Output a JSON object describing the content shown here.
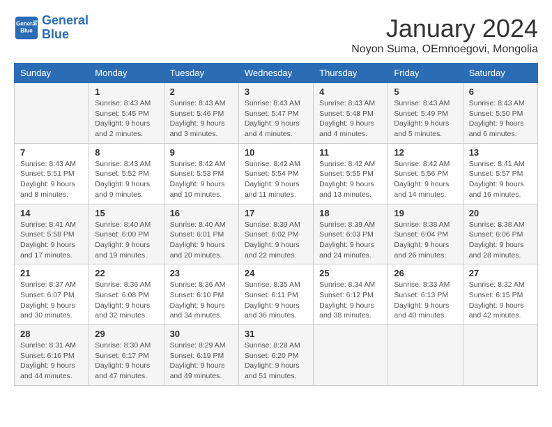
{
  "header": {
    "logo_line1": "General",
    "logo_line2": "Blue",
    "title": "January 2024",
    "subtitle": "Noyon Suma, OEmnoegovi, Mongolia"
  },
  "weekdays": [
    "Sunday",
    "Monday",
    "Tuesday",
    "Wednesday",
    "Thursday",
    "Friday",
    "Saturday"
  ],
  "weeks": [
    [
      {
        "day": "",
        "info": ""
      },
      {
        "day": "1",
        "info": "Sunrise: 8:43 AM\nSunset: 5:45 PM\nDaylight: 9 hours\nand 2 minutes."
      },
      {
        "day": "2",
        "info": "Sunrise: 8:43 AM\nSunset: 5:46 PM\nDaylight: 9 hours\nand 3 minutes."
      },
      {
        "day": "3",
        "info": "Sunrise: 8:43 AM\nSunset: 5:47 PM\nDaylight: 9 hours\nand 4 minutes."
      },
      {
        "day": "4",
        "info": "Sunrise: 8:43 AM\nSunset: 5:48 PM\nDaylight: 9 hours\nand 4 minutes."
      },
      {
        "day": "5",
        "info": "Sunrise: 8:43 AM\nSunset: 5:49 PM\nDaylight: 9 hours\nand 5 minutes."
      },
      {
        "day": "6",
        "info": "Sunrise: 8:43 AM\nSunset: 5:50 PM\nDaylight: 9 hours\nand 6 minutes."
      }
    ],
    [
      {
        "day": "7",
        "info": "Sunrise: 8:43 AM\nSunset: 5:51 PM\nDaylight: 9 hours\nand 8 minutes."
      },
      {
        "day": "8",
        "info": "Sunrise: 8:43 AM\nSunset: 5:52 PM\nDaylight: 9 hours\nand 9 minutes."
      },
      {
        "day": "9",
        "info": "Sunrise: 8:42 AM\nSunset: 5:53 PM\nDaylight: 9 hours\nand 10 minutes."
      },
      {
        "day": "10",
        "info": "Sunrise: 8:42 AM\nSunset: 5:54 PM\nDaylight: 9 hours\nand 11 minutes."
      },
      {
        "day": "11",
        "info": "Sunrise: 8:42 AM\nSunset: 5:55 PM\nDaylight: 9 hours\nand 13 minutes."
      },
      {
        "day": "12",
        "info": "Sunrise: 8:42 AM\nSunset: 5:56 PM\nDaylight: 9 hours\nand 14 minutes."
      },
      {
        "day": "13",
        "info": "Sunrise: 8:41 AM\nSunset: 5:57 PM\nDaylight: 9 hours\nand 16 minutes."
      }
    ],
    [
      {
        "day": "14",
        "info": "Sunrise: 8:41 AM\nSunset: 5:58 PM\nDaylight: 9 hours\nand 17 minutes."
      },
      {
        "day": "15",
        "info": "Sunrise: 8:40 AM\nSunset: 6:00 PM\nDaylight: 9 hours\nand 19 minutes."
      },
      {
        "day": "16",
        "info": "Sunrise: 8:40 AM\nSunset: 6:01 PM\nDaylight: 9 hours\nand 20 minutes."
      },
      {
        "day": "17",
        "info": "Sunrise: 8:39 AM\nSunset: 6:02 PM\nDaylight: 9 hours\nand 22 minutes."
      },
      {
        "day": "18",
        "info": "Sunrise: 8:39 AM\nSunset: 6:03 PM\nDaylight: 9 hours\nand 24 minutes."
      },
      {
        "day": "19",
        "info": "Sunrise: 8:38 AM\nSunset: 6:04 PM\nDaylight: 9 hours\nand 26 minutes."
      },
      {
        "day": "20",
        "info": "Sunrise: 8:38 AM\nSunset: 6:06 PM\nDaylight: 9 hours\nand 28 minutes."
      }
    ],
    [
      {
        "day": "21",
        "info": "Sunrise: 8:37 AM\nSunset: 6:07 PM\nDaylight: 9 hours\nand 30 minutes."
      },
      {
        "day": "22",
        "info": "Sunrise: 8:36 AM\nSunset: 6:08 PM\nDaylight: 9 hours\nand 32 minutes."
      },
      {
        "day": "23",
        "info": "Sunrise: 8:36 AM\nSunset: 6:10 PM\nDaylight: 9 hours\nand 34 minutes."
      },
      {
        "day": "24",
        "info": "Sunrise: 8:35 AM\nSunset: 6:11 PM\nDaylight: 9 hours\nand 36 minutes."
      },
      {
        "day": "25",
        "info": "Sunrise: 8:34 AM\nSunset: 6:12 PM\nDaylight: 9 hours\nand 38 minutes."
      },
      {
        "day": "26",
        "info": "Sunrise: 8:33 AM\nSunset: 6:13 PM\nDaylight: 9 hours\nand 40 minutes."
      },
      {
        "day": "27",
        "info": "Sunrise: 8:32 AM\nSunset: 6:15 PM\nDaylight: 9 hours\nand 42 minutes."
      }
    ],
    [
      {
        "day": "28",
        "info": "Sunrise: 8:31 AM\nSunset: 6:16 PM\nDaylight: 9 hours\nand 44 minutes."
      },
      {
        "day": "29",
        "info": "Sunrise: 8:30 AM\nSunset: 6:17 PM\nDaylight: 9 hours\nand 47 minutes."
      },
      {
        "day": "30",
        "info": "Sunrise: 8:29 AM\nSunset: 6:19 PM\nDaylight: 9 hours\nand 49 minutes."
      },
      {
        "day": "31",
        "info": "Sunrise: 8:28 AM\nSunset: 6:20 PM\nDaylight: 9 hours\nand 51 minutes."
      },
      {
        "day": "",
        "info": ""
      },
      {
        "day": "",
        "info": ""
      },
      {
        "day": "",
        "info": ""
      }
    ]
  ]
}
